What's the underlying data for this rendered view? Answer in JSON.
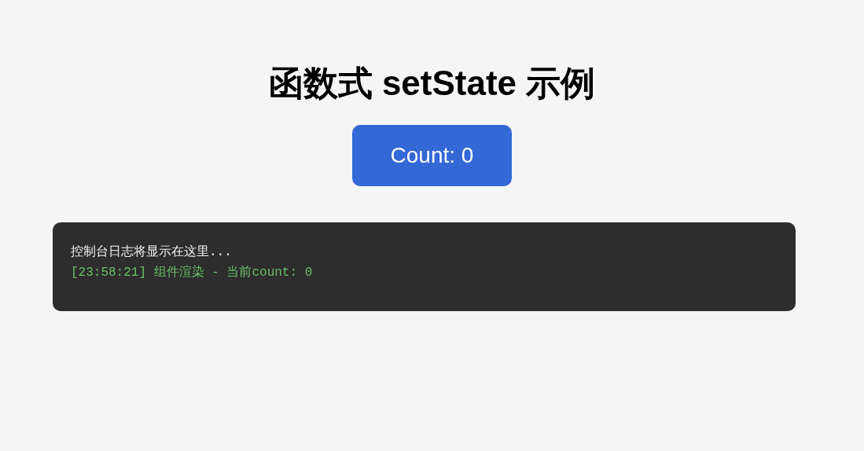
{
  "title": "函数式 setState 示例",
  "button": {
    "label": "Count: 0"
  },
  "console": {
    "lines": [
      {
        "kind": "placeholder",
        "text": "控制台日志将显示在这里..."
      },
      {
        "kind": "log",
        "text": "[23:58:21] 组件渲染 - 当前count: 0"
      }
    ]
  }
}
